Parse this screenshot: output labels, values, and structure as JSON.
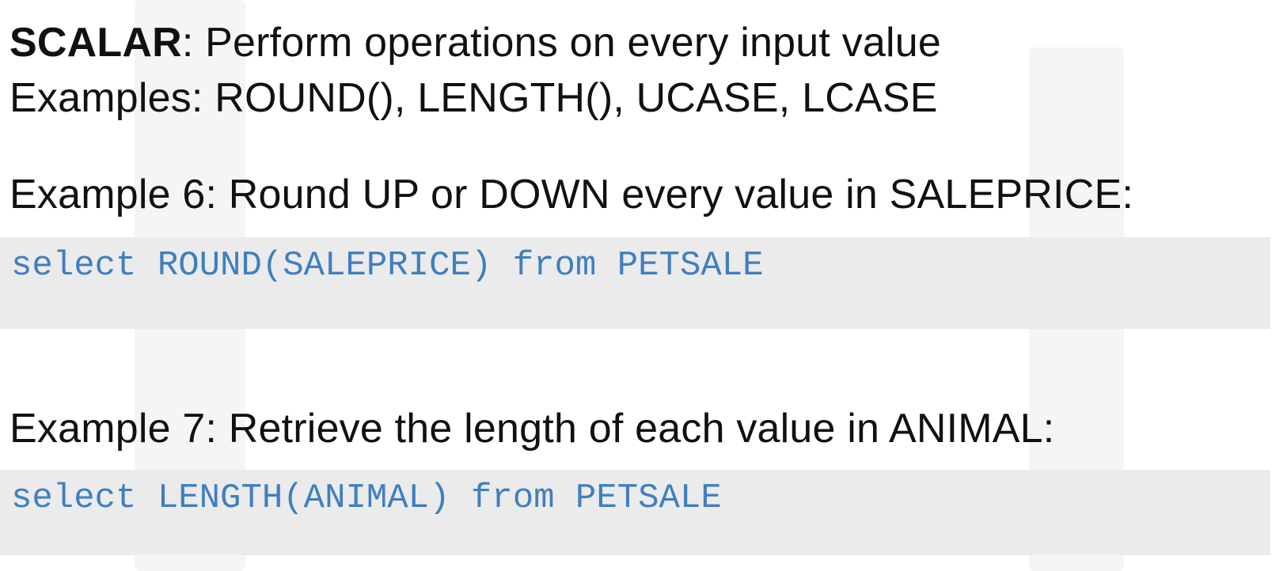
{
  "scalar": {
    "term": "SCALAR",
    "definition": ": Perform operations on every input value"
  },
  "examples_line": "Examples: ROUND(), LENGTH(), UCASE, LCASE",
  "example6": {
    "heading": "Example 6: Round UP or DOWN every value in SALEPRICE:",
    "code": "select ROUND(SALEPRICE) from PETSALE"
  },
  "example7": {
    "heading": "Example 7: Retrieve the length of each value in ANIMAL:",
    "code": "select LENGTH(ANIMAL) from PETSALE"
  }
}
